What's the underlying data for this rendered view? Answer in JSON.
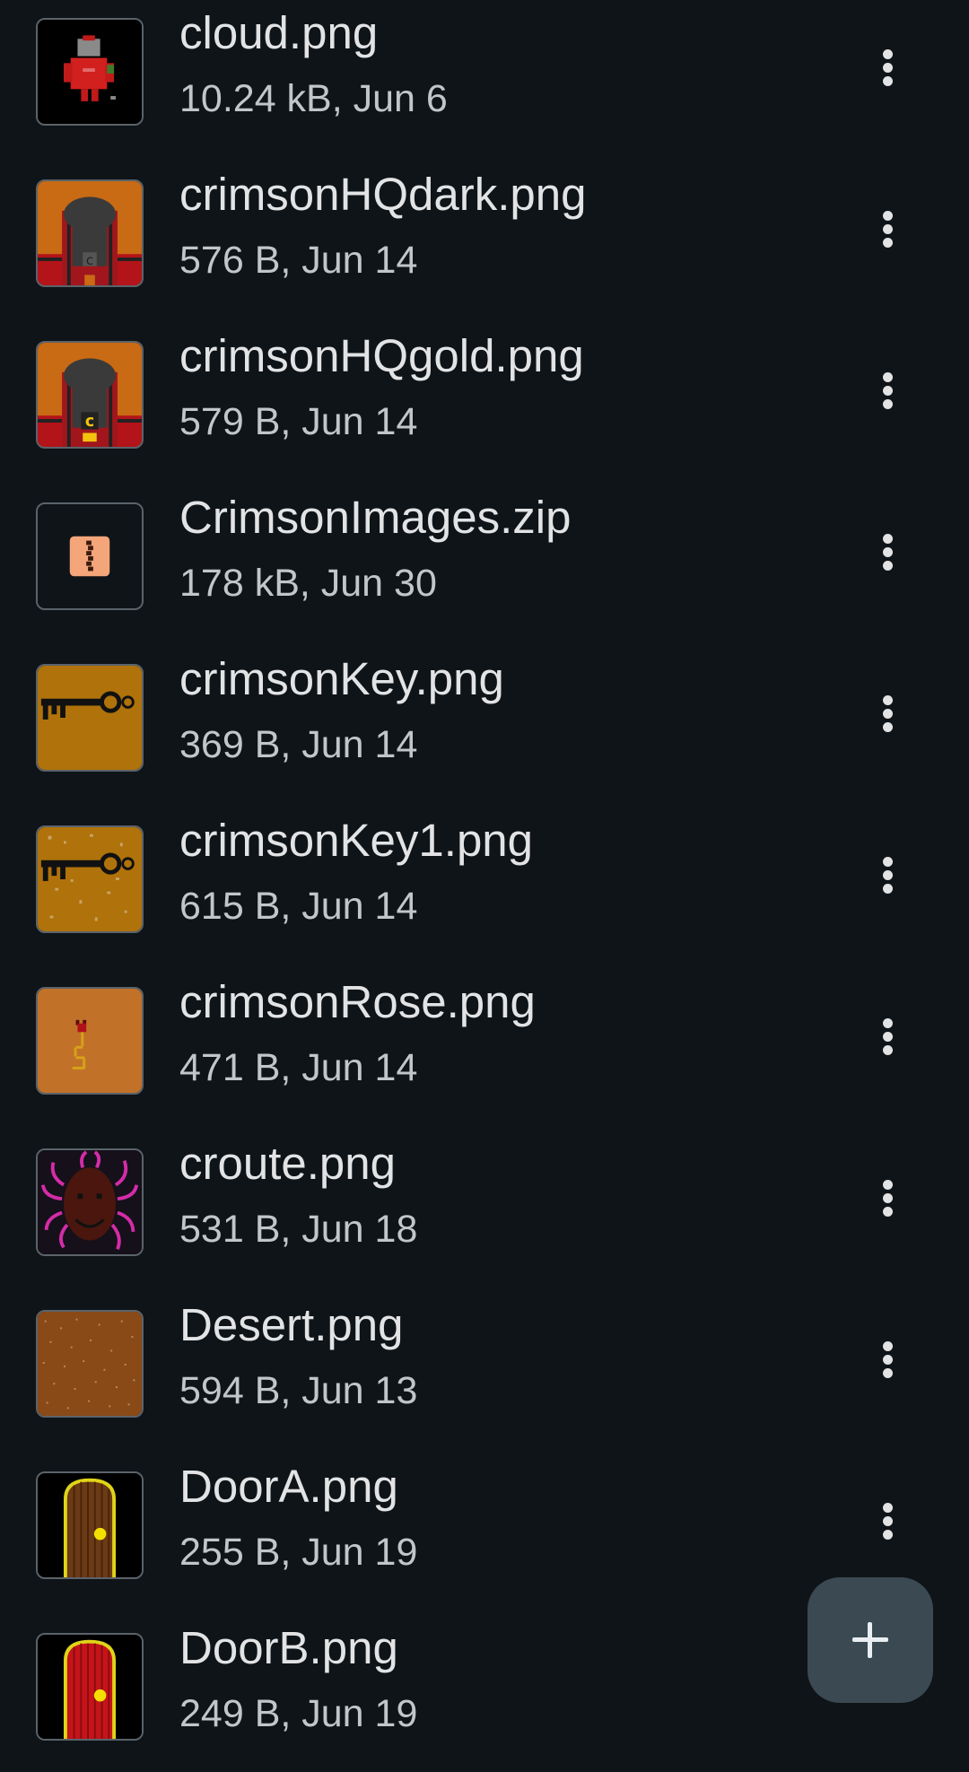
{
  "files": [
    {
      "name": "cloud.png",
      "meta": "10.24 kB, Jun 6",
      "thumb": "red-robot-sprite"
    },
    {
      "name": "crimsonHQdark.png",
      "meta": "576 B, Jun 14",
      "thumb": "crimson-hq-dark-sprite"
    },
    {
      "name": "crimsonHQgold.png",
      "meta": "579 B, Jun 14",
      "thumb": "crimson-hq-gold-sprite"
    },
    {
      "name": "CrimsonImages.zip",
      "meta": "178 kB, Jun 30",
      "thumb": "zip-file-icon"
    },
    {
      "name": "crimsonKey.png",
      "meta": "369 B, Jun 14",
      "thumb": "key-sprite"
    },
    {
      "name": "crimsonKey1.png",
      "meta": "615 B, Jun 14",
      "thumb": "key-speckled-sprite"
    },
    {
      "name": "crimsonRose.png",
      "meta": "471 B, Jun 14",
      "thumb": "rose-sprite"
    },
    {
      "name": "croute.png",
      "meta": "531 B, Jun 18",
      "thumb": "spider-face-sprite"
    },
    {
      "name": "Desert.png",
      "meta": "594 B, Jun 13",
      "thumb": "desert-texture"
    },
    {
      "name": "DoorA.png",
      "meta": "255 B, Jun 19",
      "thumb": "door-brown-sprite"
    },
    {
      "name": "DoorB.png",
      "meta": "249 B, Jun 19",
      "thumb": "door-red-sprite"
    }
  ],
  "fab": {
    "icon": "plus-icon"
  },
  "colors": {
    "background": "#0f1418",
    "primary_text": "#e2e3e4",
    "secondary_text": "#c2c6c9",
    "fab_background": "#3a4952"
  }
}
